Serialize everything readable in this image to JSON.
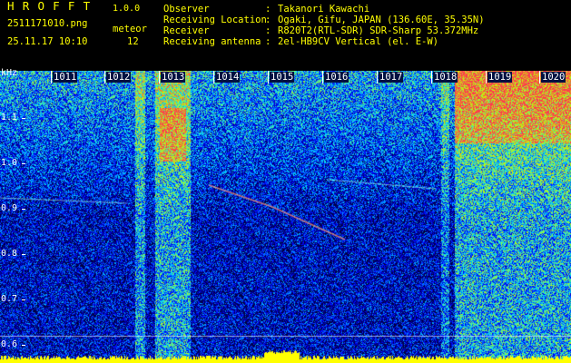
{
  "header": {
    "app_title": "HROFFT",
    "app_version": "1.0.0",
    "file_name": "2511171010.png",
    "meteor_label": "meteor",
    "date_time": "25.11.17 10:10",
    "meteor_count": "12"
  },
  "info": [
    {
      "key": "Observer",
      "sep": ":",
      "value": "Takanori Kawachi"
    },
    {
      "key": "Receiving Location",
      "sep": ":",
      "value": "Ogaki, Gifu, JAPAN (136.60E, 35.35N)"
    },
    {
      "key": "Receiver",
      "sep": ":",
      "value": "R820T2(RTL-SDR) SDR-Sharp 53.372MHz"
    },
    {
      "key": "Receiving antenna",
      "sep": ":",
      "value": "2el-HB9CV Vertical (el. E-W)"
    }
  ],
  "spectrogram": {
    "unit": "kHz",
    "time_ticks": [
      "1011",
      "1012",
      "1013",
      "1014",
      "1015",
      "1016",
      "1017",
      "1018",
      "1019",
      "1020"
    ],
    "freq_ticks": [
      "1.1",
      "1.0",
      "0.9",
      "0.8",
      "0.7",
      "0.6"
    ],
    "colors": {
      "text_yellow": "#ffff00",
      "text_cyan": "#40d0ff",
      "background": "#000000",
      "noise_floor": "#001a80"
    }
  }
}
